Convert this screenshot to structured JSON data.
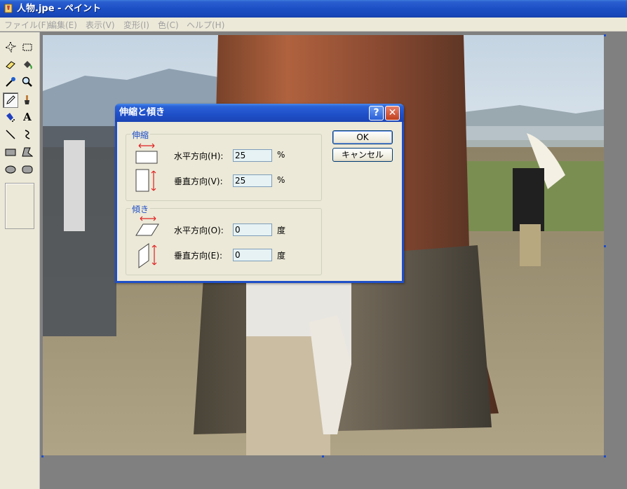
{
  "window": {
    "title": "人物.jpe - ペイント"
  },
  "menu": [
    "ファイル(F)",
    "編集(E)",
    "表示(V)",
    "変形(I)",
    "色(C)",
    "ヘルプ(H)"
  ],
  "dialog": {
    "title": "伸縮と傾き",
    "stretch": {
      "label": "伸縮",
      "horizontal_label": "水平方向(H):",
      "horizontal_value": "25",
      "vertical_label": "垂直方向(V):",
      "vertical_value": "25",
      "unit": "%"
    },
    "skew": {
      "label": "傾き",
      "horizontal_label": "水平方向(O):",
      "horizontal_value": "0",
      "vertical_label": "垂直方向(E):",
      "vertical_value": "0",
      "unit": "度"
    },
    "ok_label": "OK",
    "cancel_label": "キャンセル",
    "help_glyph": "?",
    "close_glyph": "✕"
  },
  "colors": {
    "titlebar": "#1f4fc8",
    "dialog_bg": "#ece9d8",
    "group_label": "#1f4fc8"
  }
}
